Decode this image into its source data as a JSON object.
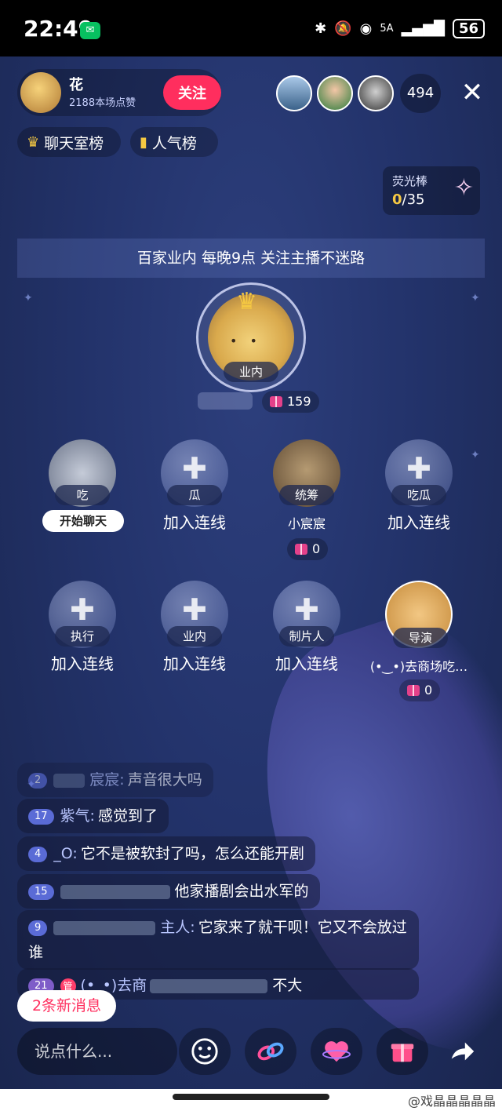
{
  "status_bar": {
    "time": "22:49",
    "network": "5A",
    "battery": "56"
  },
  "top_bar": {
    "host_name": "花",
    "host_sub": "2188本场点赞",
    "follow_label": "关注",
    "viewer_count": "494",
    "close_icon": "close-icon"
  },
  "ranks": {
    "chat_rank": "聊天室榜",
    "popularity_rank": "人气榜"
  },
  "glow_stick": {
    "title": "荧光棒",
    "current": "0",
    "total": "/35"
  },
  "banner": "百家业内  每晚9点  关注主播不迷路",
  "host_seat": {
    "tag": "业内",
    "gift_count": "159"
  },
  "seats": [
    {
      "tag": "吃",
      "action": "开始聊天"
    },
    {
      "tag": "瓜",
      "action": "加入连线"
    },
    {
      "tag": "统筹",
      "name": "小宸宸",
      "gift_count": "0"
    },
    {
      "tag": "吃瓜",
      "action": "加入连线"
    },
    {
      "tag": "执行",
      "action": "加入连线"
    },
    {
      "tag": "业内",
      "action": "加入连线"
    },
    {
      "tag": "制片人",
      "action": "加入连线"
    },
    {
      "tag": "导演",
      "name": "(•‿•)去商场吃…",
      "gift_count": "0"
    }
  ],
  "chat": [
    {
      "level": "2",
      "name": "宸宸:",
      "text": "声音很大吗"
    },
    {
      "level": "17",
      "name": "紫气:",
      "text": "感觉到了"
    },
    {
      "level": "4",
      "name": "_O:",
      "text": "它不是被软封了吗，怎么还能开剧"
    },
    {
      "level": "15",
      "name": "",
      "text": "他家播剧会出水军的"
    },
    {
      "level": "9",
      "name": "主人:",
      "text": "它家来了就干呗！它又不会放过谁"
    },
    {
      "level": "21",
      "manager": "管",
      "name": "(•_•)去商",
      "text": "不大"
    }
  ],
  "new_messages": "2条新消息",
  "bottom_bar": {
    "input_placeholder": "说点什么...",
    "emoji_icon": "emoji-icon",
    "link_icon": "link-icon",
    "heart_icon": "heart-icon",
    "gift_icon": "gift-icon",
    "share_icon": "share-icon"
  },
  "watermark": "@戏晶晶晶晶晶"
}
